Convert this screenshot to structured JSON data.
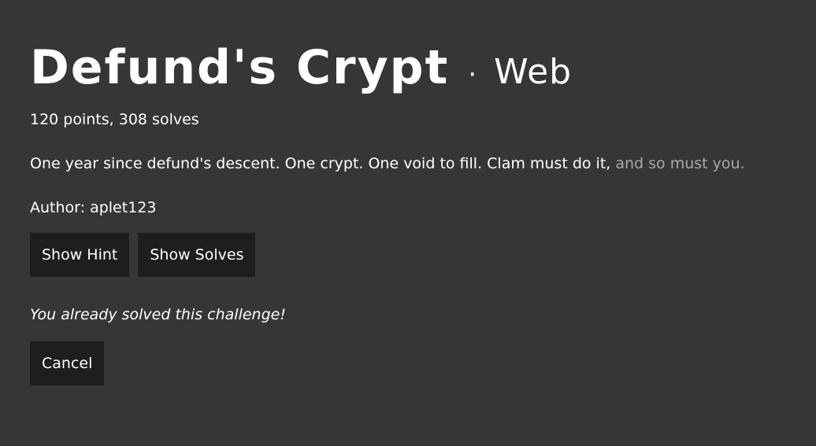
{
  "challenge": {
    "title": "Defund's Crypt",
    "separator": "·",
    "category": "Web",
    "meta": "120 points, 308 solves",
    "description_main": "One year since defund's descent. One crypt. One void to fill. Clam must do it, ",
    "description_muted": "and so must you.",
    "author": "Author: aplet123",
    "solved_message": "You already solved this challenge!"
  },
  "buttons": {
    "show_hint": "Show Hint",
    "show_solves": "Show Solves",
    "cancel": "Cancel"
  },
  "colors": {
    "background": "#363636",
    "button_bg": "#1e1e1e",
    "text": "#ffffff",
    "muted_text": "#a9a9a9"
  }
}
